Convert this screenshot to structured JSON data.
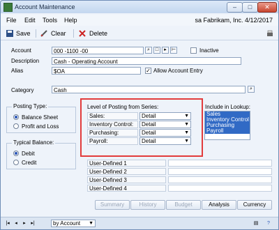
{
  "window": {
    "title": "Account Maintenance"
  },
  "menu": {
    "items": [
      "File",
      "Edit",
      "Tools",
      "Help"
    ],
    "company": "sa  Fabrikam, Inc. 4/12/2017"
  },
  "toolbar": {
    "save": "Save",
    "clear": "Clear",
    "delete": "Delete"
  },
  "account": {
    "account_label": "Account",
    "account_value": "000 -1100 -00",
    "inactive_label": "Inactive",
    "description_label": "Description",
    "description_value": "Cash - Operating Account",
    "alias_label": "Alias",
    "alias_value": "$OA",
    "allow_entry_label": "Allow Account Entry",
    "allow_entry_checked": "✓",
    "category_label": "Category",
    "category_value": "Cash"
  },
  "posting_type": {
    "title": "Posting Type:",
    "options": [
      "Balance Sheet",
      "Profit and Loss"
    ],
    "selected": "Balance Sheet"
  },
  "typical_balance": {
    "title": "Typical Balance:",
    "options": [
      "Debit",
      "Credit"
    ],
    "selected": "Debit"
  },
  "level_of_posting": {
    "title": "Level of Posting from Series:",
    "rows": [
      {
        "label": "Sales:",
        "value": "Detail"
      },
      {
        "label": "Inventory Control:",
        "value": "Detail"
      },
      {
        "label": "Purchasing:",
        "value": "Detail"
      },
      {
        "label": "Payroll:",
        "value": "Detail"
      }
    ]
  },
  "include_lookup": {
    "title": "Include in Lookup:",
    "items": [
      "Sales",
      "Inventory Control",
      "Purchasing",
      "Payroll"
    ]
  },
  "user_defined": [
    "User-Defined 1",
    "User-Defined 2",
    "User-Defined 3",
    "User-Defined 4"
  ],
  "buttons": {
    "summary": "Summary",
    "history": "History",
    "budget": "Budget",
    "analysis": "Analysis",
    "currency": "Currency"
  },
  "status": {
    "sort": "by Account"
  },
  "colors": {
    "highlight_box": "#e23b3b",
    "selection": "#316ac5"
  }
}
